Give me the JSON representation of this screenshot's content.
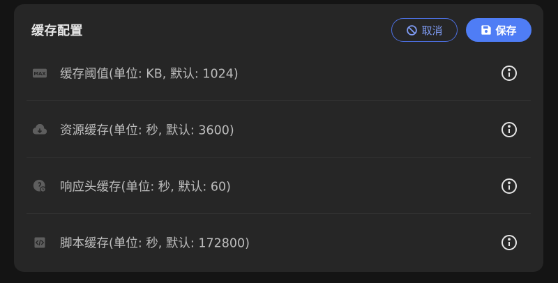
{
  "header": {
    "title": "缓存配置",
    "cancel_label": "取消",
    "save_label": "保存"
  },
  "rows": [
    {
      "icon": "max-badge-icon",
      "label": "缓存阈值(单位: KB, 默认: 1024)"
    },
    {
      "icon": "cloud-download-icon",
      "label": "资源缓存(单位: 秒, 默认: 3600)"
    },
    {
      "icon": "header-cache-icon",
      "label": "响应头缓存(单位: 秒, 默认: 60)"
    },
    {
      "icon": "code-file-icon",
      "label": "脚本缓存(单位: 秒, 默认: 172800)"
    }
  ],
  "colors": {
    "background": "#141414",
    "panel": "#262626",
    "accent": "#4f7df5",
    "cancel_border": "#4c6fe0",
    "text": "#bdbdbd"
  }
}
